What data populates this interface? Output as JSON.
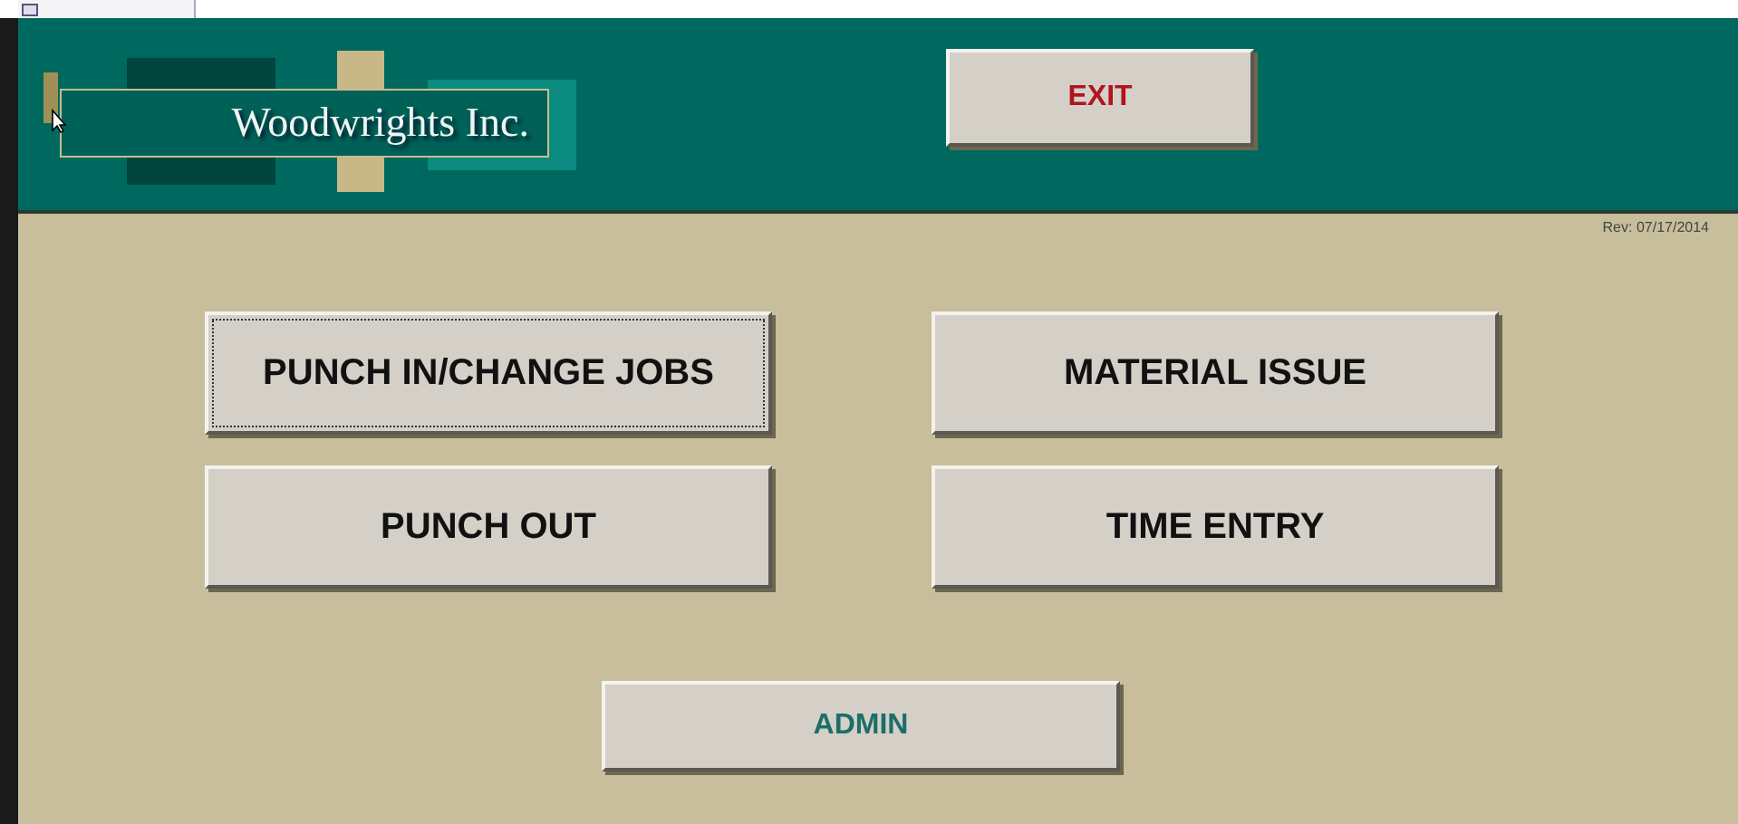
{
  "header": {
    "logo_text": "Woodwrights Inc.",
    "exit_button": {
      "label": "EXIT",
      "color": "#b0141e"
    }
  },
  "revision": "Rev: 07/17/2014",
  "buttons": [
    {
      "label": "PUNCH IN/CHANGE JOBS",
      "focused": true
    },
    {
      "label": "MATERIAL ISSUE",
      "focused": false
    },
    {
      "label": "PUNCH OUT",
      "focused": false
    },
    {
      "label": "TIME ENTRY",
      "focused": false
    }
  ],
  "admin_button": {
    "label": "ADMIN",
    "color": "#1d6e6a"
  }
}
